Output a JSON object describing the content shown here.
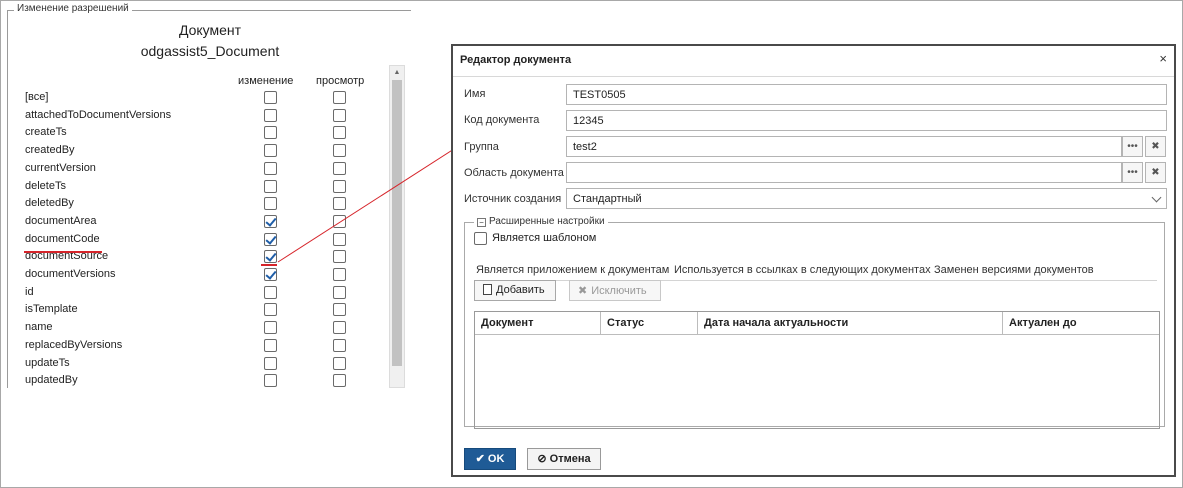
{
  "permissions": {
    "legend": "Изменение разрешений",
    "entity_title": "Документ",
    "entity_name": "odgassist5_Document",
    "col_edit": "изменение",
    "col_view": "просмотр",
    "rows": [
      {
        "name": "[все]",
        "edit": false,
        "view": false
      },
      {
        "name": "attachedToDocumentVersions",
        "edit": false,
        "view": false
      },
      {
        "name": "createTs",
        "edit": false,
        "view": false
      },
      {
        "name": "createdBy",
        "edit": false,
        "view": false
      },
      {
        "name": "currentVersion",
        "edit": false,
        "view": false
      },
      {
        "name": "deleteTs",
        "edit": false,
        "view": false
      },
      {
        "name": "deletedBy",
        "edit": false,
        "view": false
      },
      {
        "name": "documentArea",
        "edit": true,
        "view": false
      },
      {
        "name": "documentCode",
        "edit": true,
        "view": false
      },
      {
        "name": "documentSource",
        "edit": true,
        "view": false
      },
      {
        "name": "documentVersions",
        "edit": true,
        "view": false
      },
      {
        "name": "id",
        "edit": false,
        "view": false
      },
      {
        "name": "isTemplate",
        "edit": false,
        "view": false
      },
      {
        "name": "name",
        "edit": false,
        "view": false
      },
      {
        "name": "replacedByVersions",
        "edit": false,
        "view": false
      },
      {
        "name": "updateTs",
        "edit": false,
        "view": false
      },
      {
        "name": "updatedBy",
        "edit": false,
        "view": false
      }
    ]
  },
  "dialog": {
    "title": "Редактор документа",
    "close_glyph": "×",
    "fields": {
      "name_label": "Имя",
      "name_value": "TEST0505",
      "code_label": "Код документа",
      "code_value": "12345",
      "group_label": "Группа",
      "group_value": "test2",
      "area_label": "Область документа",
      "area_value": "",
      "source_label": "Источник создания",
      "source_value": "Стандартный"
    },
    "advanced": {
      "legend": "Расширенные настройки",
      "toggle_glyph": "−",
      "template_label": "Является шаблоном",
      "template_checked": false,
      "tabs": [
        "Является приложением к документам",
        "Используется в ссылках в следующих документах",
        "Заменен версиями документов"
      ],
      "add_label": "Добавить",
      "exclude_label": "Исключить",
      "columns": [
        "Документ",
        "Статус",
        "Дата начала актуальности",
        "Актуален до"
      ]
    },
    "ok_label": "OK",
    "cancel_label": "Отмена"
  },
  "colors": {
    "annotation": "#d6242a",
    "check": "#1f5ea8",
    "ok_button": "#1f5b96"
  }
}
